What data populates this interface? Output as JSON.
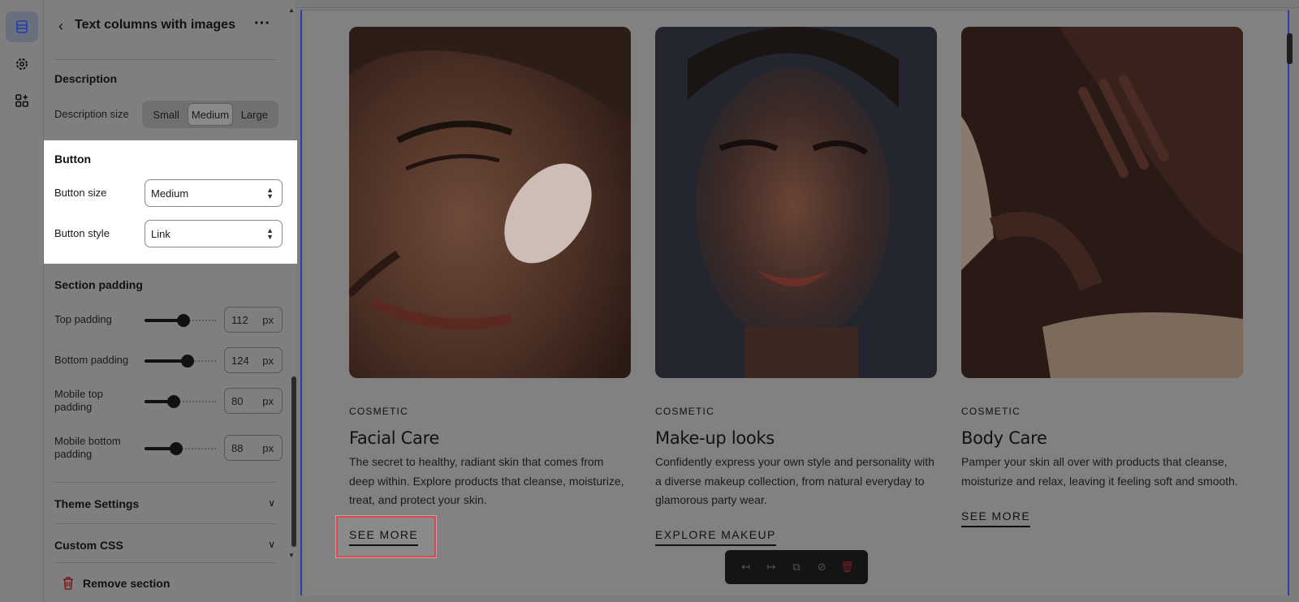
{
  "rail": {
    "items": [
      {
        "name": "sections",
        "icon": "layers-icon",
        "active": true
      },
      {
        "name": "settings",
        "icon": "gear-icon",
        "active": false
      },
      {
        "name": "apps",
        "icon": "apps-add-icon",
        "active": false
      }
    ]
  },
  "panel": {
    "title": "Text columns with images",
    "description": {
      "heading": "Description",
      "size_label": "Description size",
      "size_options": [
        "Small",
        "Medium",
        "Large"
      ],
      "size_selected": "Medium"
    },
    "button": {
      "heading": "Button",
      "size_label": "Button size",
      "size_value": "Medium",
      "style_label": "Button style",
      "style_value": "Link"
    },
    "padding": {
      "heading": "Section padding",
      "rows": [
        {
          "label": "Top padding",
          "value": "112",
          "unit": "px",
          "fraction": 0.55
        },
        {
          "label": "Bottom padding",
          "value": "124",
          "unit": "px",
          "fraction": 0.6
        },
        {
          "label": "Mobile top padding",
          "value": "80",
          "unit": "px",
          "fraction": 0.41
        },
        {
          "label": "Mobile bottom padding",
          "value": "88",
          "unit": "px",
          "fraction": 0.44
        }
      ]
    },
    "accordions": [
      "Theme Settings",
      "Custom CSS"
    ],
    "remove_label": "Remove section"
  },
  "preview": {
    "columns": [
      {
        "eyebrow": "COSMETIC",
        "title": "Facial Care",
        "description": "The secret to healthy, radiant skin that comes from deep within. Explore products that cleanse, moisturize, treat, and protect your skin.",
        "cta": "SEE MORE"
      },
      {
        "eyebrow": "COSMETIC",
        "title": "Make-up looks",
        "description": "Confidently express your own style and personality with a diverse makeup collection, from natural everyday to glamorous party wear.",
        "cta": "EXPLORE MAKEUP"
      },
      {
        "eyebrow": "COSMETIC",
        "title": "Body Care",
        "description": "Pamper your skin all over with products that cleanse, moisturize and relax, leaving it feeling soft and smooth.",
        "cta": "SEE MORE"
      }
    ],
    "toolbar": {
      "icons": [
        "move-up-icon",
        "move-down-icon",
        "duplicate-icon",
        "hide-icon",
        "delete-icon"
      ]
    }
  },
  "colors": {
    "highlight_border": "#e4454c",
    "selection_outline": "#2d3ea8",
    "overlay_gray": "#7f7f7f"
  }
}
